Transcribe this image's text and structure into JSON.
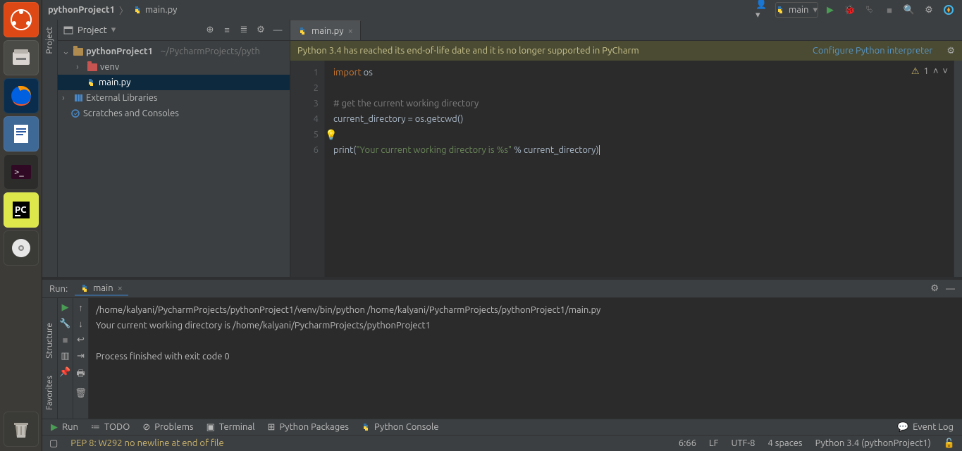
{
  "breadcrumbs": {
    "project": "pythonProject1",
    "file": "main.py"
  },
  "toolbar": {
    "run_config": "main"
  },
  "project_pane": {
    "title": "Project",
    "root": "pythonProject1",
    "root_path": "~/PycharmProjects/pyth",
    "venv": "venv",
    "main": "main.py",
    "ext": "External Libraries",
    "scratches": "Scratches and Consoles"
  },
  "tab": {
    "name": "main.py"
  },
  "notice": {
    "text": "Python 3.4 has reached its end-of-life date and it is no longer supported in PyCharm",
    "link": "Configure Python interpreter"
  },
  "code": {
    "lines": [
      "1",
      "2",
      "3",
      "4",
      "5",
      "6"
    ],
    "l1_kw": "import",
    "l1_mod": "os",
    "l3_comment": "# get the current working directory",
    "l4": "current_directory = os.getcwd()",
    "l6_fn": "print",
    "l6_p1": "(",
    "l6_str": "\"Your current working directory is %s\"",
    "l6_mid": " % current_directory",
    "l6_p2": ")",
    "badge_count": "1"
  },
  "run": {
    "label": "Run:",
    "config": "main",
    "line1": "/home/kalyani/PycharmProjects/pythonProject1/venv/bin/python /home/kalyani/PycharmProjects/pythonProject1/main.py",
    "line2": "Your current working directory is /home/kalyani/PycharmProjects/pythonProject1",
    "line3": "",
    "line4": "Process finished with exit code 0"
  },
  "left_rail": {
    "project": "Project",
    "structure": "Structure",
    "favorites": "Favorites"
  },
  "bottom": {
    "run": "Run",
    "todo": "TODO",
    "problems": "Problems",
    "terminal": "Terminal",
    "pkgs": "Python Packages",
    "pyconsole": "Python Console",
    "eventlog": "Event Log"
  },
  "status": {
    "msg": "PEP 8: W292 no newline at end of file",
    "pos": "6:66",
    "lf": "LF",
    "enc": "UTF-8",
    "indent": "4 spaces",
    "sdk": "Python 3.4 (pythonProject1)"
  }
}
